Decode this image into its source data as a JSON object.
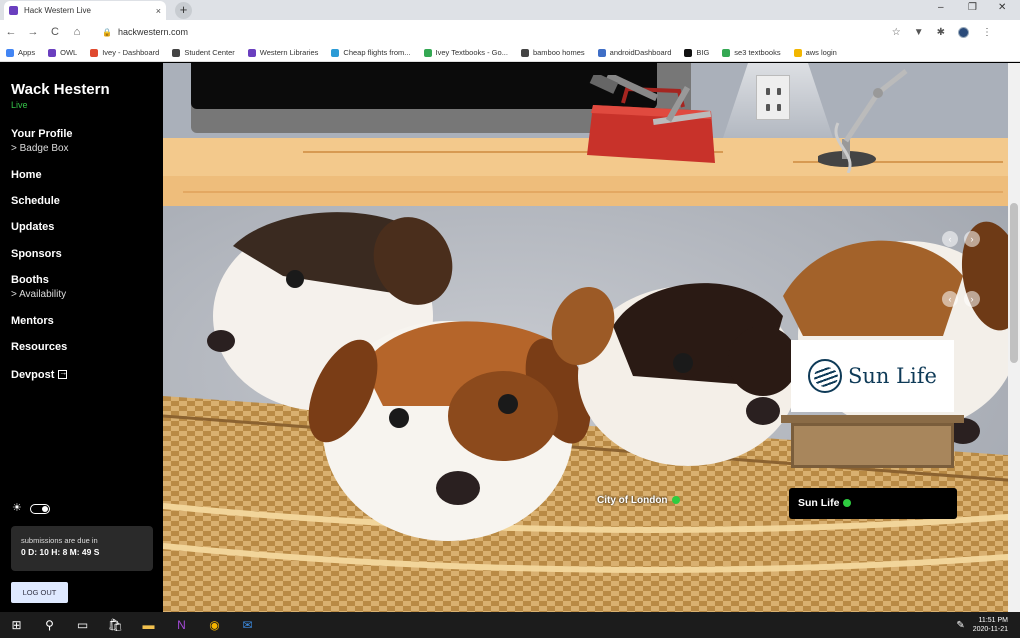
{
  "browser": {
    "tab_title": "Hack Western Live",
    "tab_close": "×",
    "new_tab": "+",
    "url": "hackwestern.com",
    "nav_back": "←",
    "nav_forward": "→",
    "nav_reload": "C",
    "nav_home": "⌂",
    "win_min": "–",
    "win_max": "❐",
    "win_close": "✕"
  },
  "bookmarks": [
    {
      "label": "Apps",
      "color": "#4285f4"
    },
    {
      "label": "OWL",
      "color": "#6a3fbf"
    },
    {
      "label": "Ivey - Dashboard",
      "color": "#e04a2f"
    },
    {
      "label": "Student Center",
      "color": "#444444"
    },
    {
      "label": "Western Libraries",
      "color": "#6a3fbf"
    },
    {
      "label": "Cheap flights from...",
      "color": "#2b9bd6"
    },
    {
      "label": "Ivey Textbooks - Go...",
      "color": "#34a853"
    },
    {
      "label": "bamboo homes",
      "color": "#444444"
    },
    {
      "label": "androidDashboard",
      "color": "#3f6ec6"
    },
    {
      "label": "BIG",
      "color": "#111111"
    },
    {
      "label": "se3 textbooks",
      "color": "#34a853"
    },
    {
      "label": "aws login",
      "color": "#f2b600"
    }
  ],
  "sidebar": {
    "brand": "Wack Hestern",
    "status": "Live",
    "profile": "Your Profile",
    "badge_box": "> Badge Box",
    "home": "Home",
    "schedule": "Schedule",
    "updates": "Updates",
    "sponsors": "Sponsors",
    "booths": "Booths",
    "availability": "> Availability",
    "mentors": "Mentors",
    "resources": "Resources",
    "devpost": "Devpost",
    "due_label": "submissions are due in",
    "due_value": "0 D: 10 H: 8 M: 49 S",
    "logout": "LOG OUT"
  },
  "main": {
    "sponsor_logo_text": "Sun Life",
    "location_label": "City of London",
    "booth_badge": "Sun Life",
    "arrow_left": "‹",
    "arrow_right": "›"
  },
  "taskbar": {
    "time": "11:51 PM",
    "date": "2020-11-21"
  },
  "colors": {
    "live_green": "#35c44a",
    "status_dot": "#2ecc40",
    "sunlife_navy": "#0e3a57"
  }
}
